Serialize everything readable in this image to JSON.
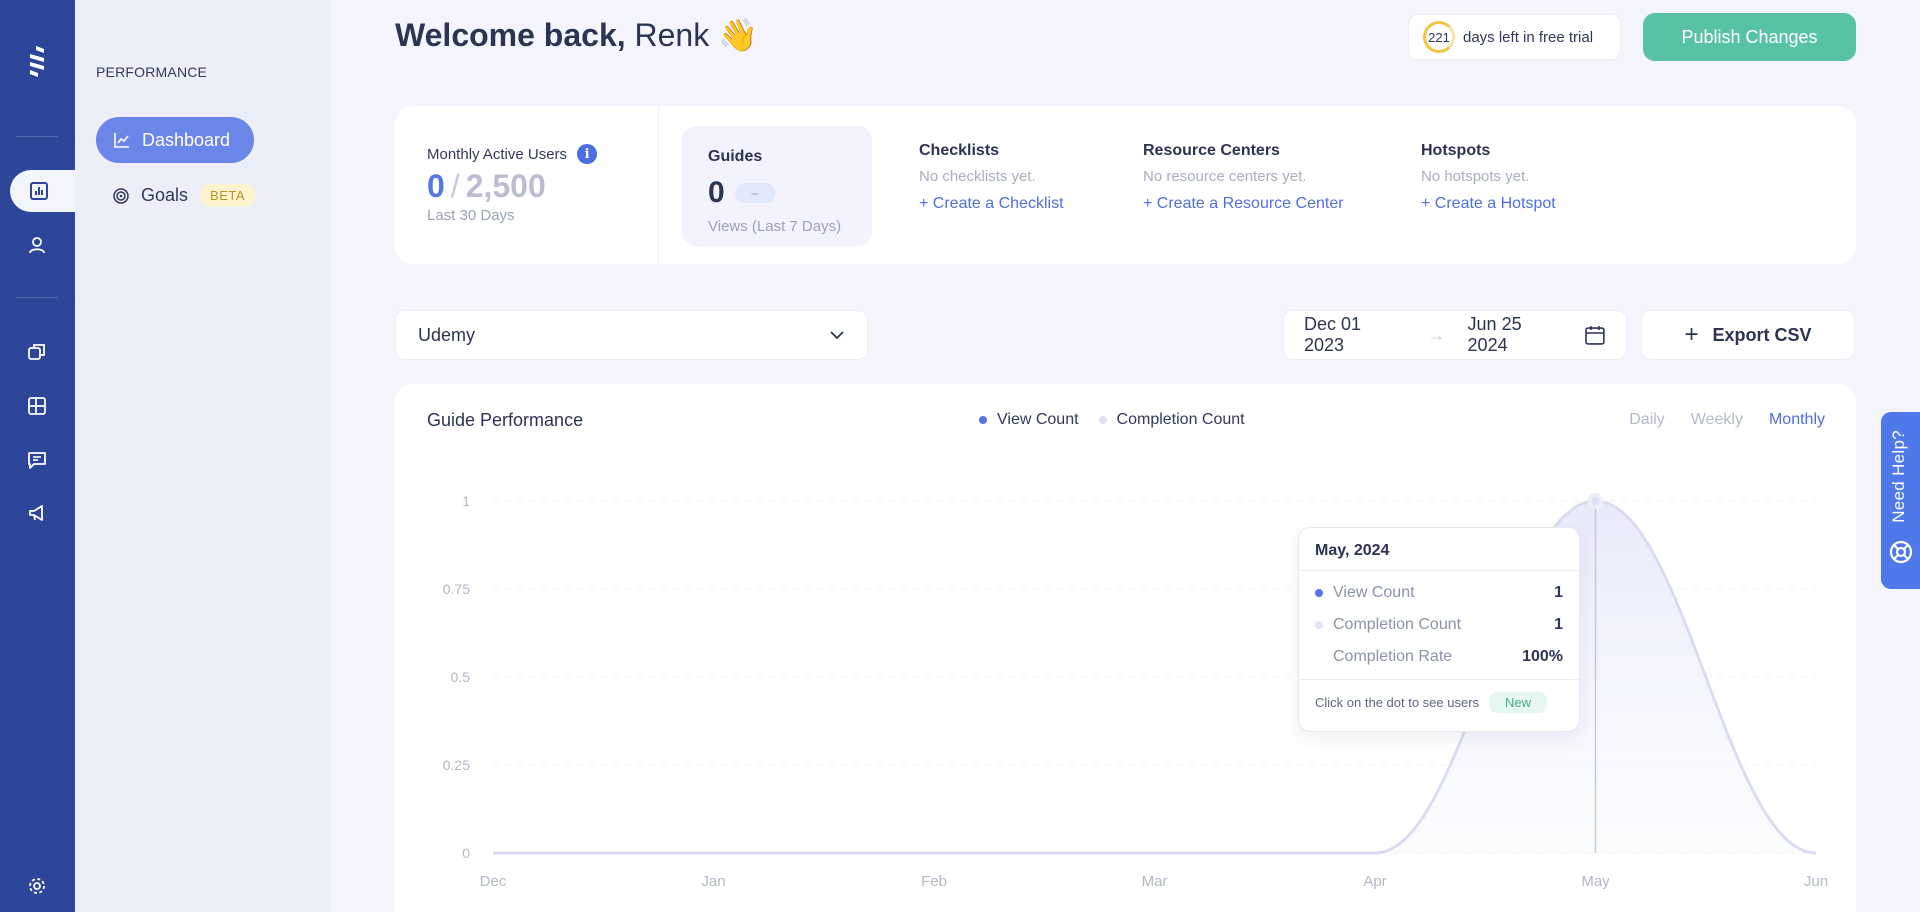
{
  "rail": {
    "icons": [
      "logo",
      "chart-icon",
      "user-icon",
      "copy-icon",
      "layout-icon",
      "chat-icon",
      "megaphone-icon",
      "settings-icon"
    ]
  },
  "sidebar": {
    "section": "PERFORMANCE",
    "items": [
      {
        "label": "Dashboard",
        "icon": "line-chart-icon",
        "active": true
      },
      {
        "label": "Goals",
        "icon": "target-icon",
        "badge": "BETA"
      }
    ]
  },
  "header": {
    "welcome": "Welcome back,",
    "name": "Renk",
    "emoji": "👋",
    "trial_days": "221",
    "trial_text": "days left in free trial",
    "publish_label": "Publish Changes"
  },
  "stats": {
    "mau": {
      "label": "Monthly Active Users",
      "value": "0",
      "slash": "/",
      "total": "2,500",
      "sub": "Last 30 Days"
    },
    "guides": {
      "title": "Guides",
      "value": "0",
      "pill": "–",
      "sub": "Views (Last 7 Days)"
    },
    "checklists": {
      "title": "Checklists",
      "empty": "No checklists yet.",
      "action": "+ Create a Checklist"
    },
    "resource_centers": {
      "title": "Resource Centers",
      "empty": "No resource centers yet.",
      "action": "+ Create a Resource Center"
    },
    "hotspots": {
      "title": "Hotspots",
      "empty": "No hotspots yet.",
      "action": "+ Create a Hotspot"
    }
  },
  "filters": {
    "app": "Udemy",
    "date_from": "Dec 01 2023",
    "date_to": "Jun 25 2024",
    "export_label": "Export CSV"
  },
  "chart_card": {
    "title": "Guide Performance",
    "legend": [
      {
        "label": "View Count",
        "color": "#5a73e3"
      },
      {
        "label": "Completion Count",
        "color": "#dfe2f1"
      }
    ],
    "periods": [
      "Daily",
      "Weekly",
      "Monthly"
    ],
    "active_period": "Monthly"
  },
  "chart_data": {
    "type": "area",
    "categories": [
      "Dec",
      "Jan",
      "Feb",
      "Mar",
      "Apr",
      "May",
      "Jun"
    ],
    "series": [
      {
        "name": "View Count",
        "values": [
          0,
          0,
          0,
          0,
          0,
          1,
          0
        ]
      },
      {
        "name": "Completion Count",
        "values": [
          0,
          0,
          0,
          0,
          0,
          1,
          0
        ]
      }
    ],
    "yticks": [
      "1",
      "0.75",
      "0.5",
      "0.25",
      "0"
    ],
    "ylim": [
      0,
      1
    ],
    "grid": true
  },
  "tooltip": {
    "title": "May, 2024",
    "rows": [
      {
        "label": "View Count",
        "value": "1",
        "color": "#5a73e3"
      },
      {
        "label": "Completion Count",
        "value": "1",
        "color": "#dfe2f1"
      },
      {
        "label": "Completion Rate",
        "value": "100%"
      }
    ],
    "footer": "Click on the dot to see users",
    "badge": "New"
  },
  "help": {
    "label": "Need Help?"
  }
}
